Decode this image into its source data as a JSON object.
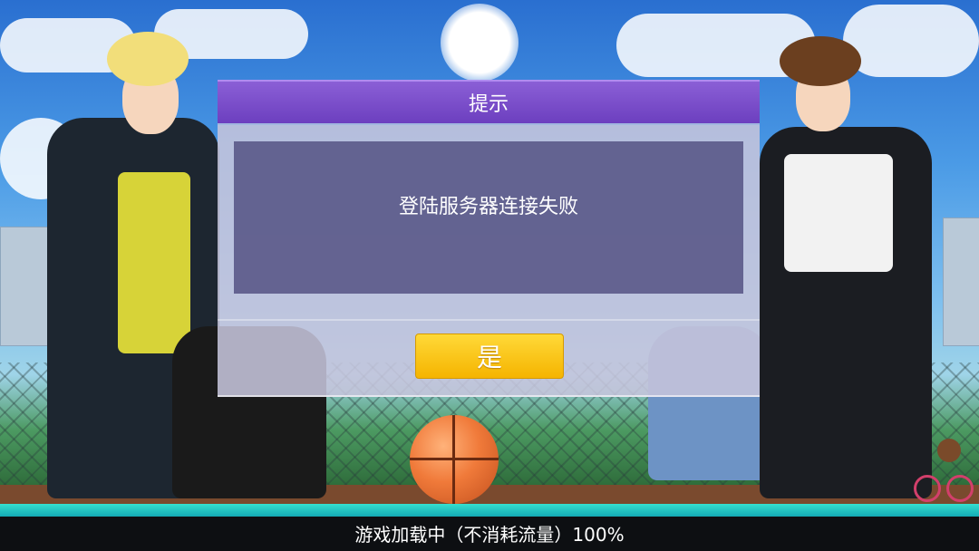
{
  "dialog": {
    "title": "提示",
    "message": "登陆服务器连接失败",
    "confirm_label": "是"
  },
  "loading": {
    "text": "游戏加载中（不消耗流量）100%",
    "progress": 1.0
  },
  "colors": {
    "header": "#7a4bcc",
    "button": "#f8c51a",
    "progress": "#1fc3c1"
  }
}
